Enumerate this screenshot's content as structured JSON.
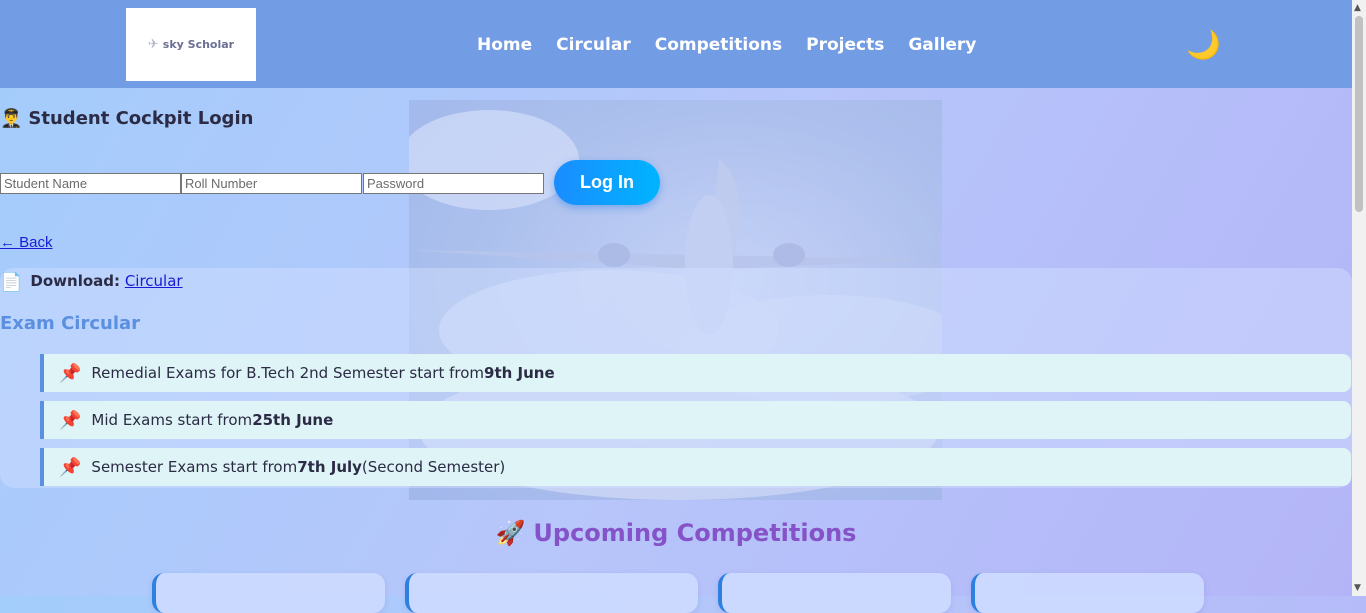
{
  "header": {
    "logo_text": "sky Scholar",
    "nav": [
      "Home",
      "Circular",
      "Competitions",
      "Projects",
      "Gallery"
    ],
    "theme_icon": "🌙"
  },
  "login": {
    "title_icon": "👨‍✈️",
    "title": "Student Cockpit Login",
    "name_placeholder": "Student Name",
    "roll_placeholder": "Roll Number",
    "password_placeholder": "Password",
    "button": "Log In",
    "back": "← Back"
  },
  "download": {
    "icon": "📄",
    "label": "Download:",
    "link": "Circular"
  },
  "exam_circular": {
    "title": "Exam Circular",
    "pin_icon": "📌",
    "items": [
      {
        "text": "Remedial Exams for B.Tech 2nd Semester start from",
        "bold": "9th June",
        "suffix": ""
      },
      {
        "text": "Mid Exams start from",
        "bold": "25th June",
        "suffix": ""
      },
      {
        "text": "Semester Exams start from",
        "bold": "7th July",
        "suffix": "(Second Semester)"
      }
    ]
  },
  "competitions": {
    "icon": "🚀",
    "title": "Upcoming Competitions"
  }
}
